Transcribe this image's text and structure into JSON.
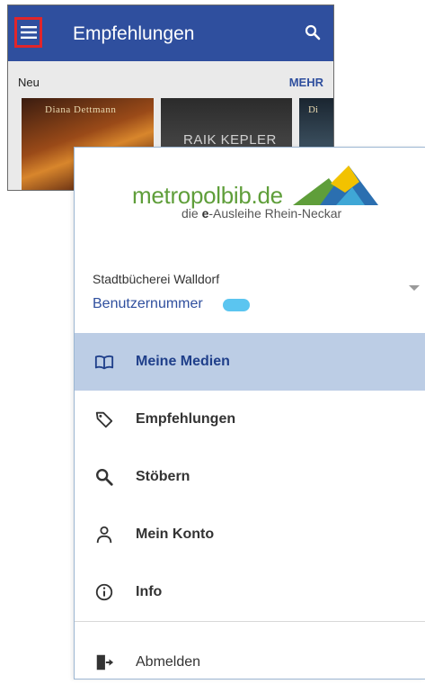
{
  "background_app": {
    "title": "Empfehlungen",
    "section_label": "Neu",
    "more_link": "MEHR",
    "covers": [
      {
        "author": "Diana Dettmann"
      },
      {
        "author": "RAIK KEPLER"
      },
      {
        "author": "Di"
      }
    ]
  },
  "drawer": {
    "logo": {
      "name": "metropolbib.de",
      "tagline_prefix": "die ",
      "tagline_bold": "e",
      "tagline_suffix": "-Ausleihe Rhein-Neckar"
    },
    "library_name": "Stadtbücherei Walldorf",
    "user_number_label": "Benutzernummer",
    "nav": {
      "meine_medien": "Meine Medien",
      "empfehlungen": "Empfehlungen",
      "stoebern": "Stöbern",
      "mein_konto": "Mein Konto",
      "info": "Info",
      "abmelden": "Abmelden"
    }
  },
  "colors": {
    "app_bar": "#2f4f9e",
    "highlight": "#e1252a",
    "active_item": "#bccde5",
    "logo_green": "#5f9e3a"
  }
}
